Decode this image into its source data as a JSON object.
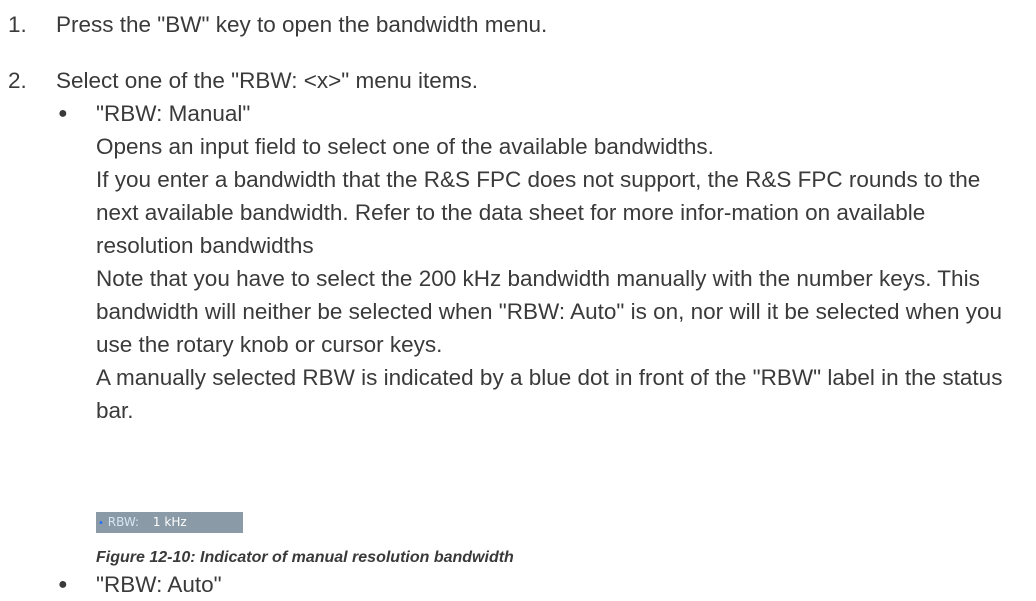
{
  "steps": [
    {
      "num": "1.",
      "text": "Press the \"BW\" key to open the bandwidth menu."
    },
    {
      "num": "2.",
      "text": "Select one of the \"RBW: <x>\" menu items."
    }
  ],
  "bullet_glyph": "●",
  "bullets": [
    {
      "title": "\"RBW: Manual\"",
      "paragraphs": [
        "Opens an input field to select one of the available bandwidths.",
        "If you enter a bandwidth that the R&S FPC does not support, the R&S FPC rounds to the next available bandwidth. Refer to the data sheet for more infor-mation on available resolution bandwidths",
        "Note that you have to select the 200 kHz bandwidth manually with the number keys. This bandwidth will neither be selected when \"RBW: Auto\" is on, nor will it be selected when you use the rotary knob or cursor keys.",
        "A manually selected RBW is indicated by a blue dot in front of the \"RBW\" label in the status bar."
      ]
    },
    {
      "title": "\"RBW: Auto\""
    }
  ],
  "statusbar": {
    "dot": "•",
    "label": "RBW:",
    "value": "1 kHz",
    "dot_color": "#1e6fff",
    "bg_color": "#8a9aa6"
  },
  "figure_caption": "Figure 12-10: Indicator of manual resolution bandwidth"
}
